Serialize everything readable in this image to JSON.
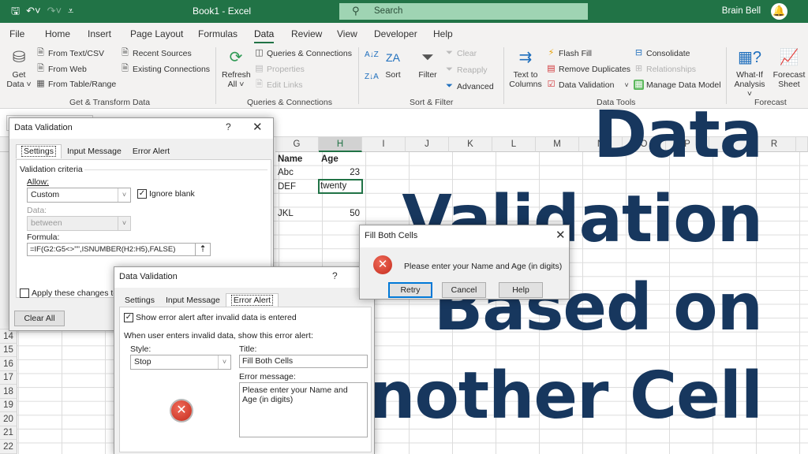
{
  "titlebar": {
    "title": "Book1  -  Excel",
    "search_placeholder": "Search",
    "user_name": "Brain Bell",
    "qat": [
      "save-icon",
      "undo-icon",
      "redo-icon",
      "customize-icon"
    ]
  },
  "menu": {
    "tabs": [
      "File",
      "Home",
      "Insert",
      "Page Layout",
      "Formulas",
      "Data",
      "Review",
      "View",
      "Developer",
      "Help"
    ],
    "active": "Data"
  },
  "ribbon": {
    "get_transform": {
      "label": "Get & Transform Data",
      "get_data": "Get",
      "get_data2": "Data ˅",
      "from_text_csv": "From Text/CSV",
      "from_web": "From Web",
      "from_table_range": "From Table/Range",
      "recent_sources": "Recent Sources",
      "existing_connections": "Existing Connections"
    },
    "queries": {
      "label": "Queries & Connections",
      "refresh": "Refresh",
      "refresh2": "All ˅",
      "queries_connections": "Queries & Connections",
      "properties": "Properties",
      "edit_links": "Edit Links"
    },
    "sort_filter": {
      "label": "Sort & Filter",
      "sort": "Sort",
      "filter": "Filter",
      "clear": "Clear",
      "reapply": "Reapply",
      "advanced": "Advanced"
    },
    "data_tools": {
      "label": "Data Tools",
      "text_to": "Text to",
      "columns": "Columns",
      "flash_fill": "Flash Fill",
      "remove_duplicates": "Remove Duplicates",
      "data_validation": "Data Validation",
      "consolidate": "Consolidate",
      "relationships": "Relationships",
      "manage_data_model": "Manage Data Model"
    },
    "forecast": {
      "label": "Forecast",
      "what_if": "What-If",
      "what_if2": "Analysis ˅",
      "forecast_sheet": "Forecast",
      "forecast_sheet2": "Sheet"
    }
  },
  "grid": {
    "columns": [
      "G",
      "H",
      "I",
      "J",
      "K",
      "L",
      "M",
      "N",
      "O",
      "P",
      "Q",
      "R"
    ],
    "selected_column": "H",
    "rows_visible": [
      "14",
      "15",
      "16",
      "17",
      "18",
      "19",
      "20",
      "21",
      "22"
    ],
    "cells": {
      "G1": "Name",
      "H1": "Age",
      "G2": "Abc",
      "H2": "23",
      "G3": "DEF",
      "H3": "twenty",
      "G5": "JKL",
      "H5": "50"
    },
    "active_cell": "H3"
  },
  "dv_settings": {
    "title": "Data Validation",
    "help": "?",
    "close": "✕",
    "tabs": [
      "Settings",
      "Input Message",
      "Error Alert"
    ],
    "active_tab": "Settings",
    "section": "Validation criteria",
    "allow_label": "Allow:",
    "allow_value": "Custom",
    "ignore_blank_label": "Ignore blank",
    "ignore_blank_checked": true,
    "data_label": "Data:",
    "data_value": "between",
    "formula_label": "Formula:",
    "formula_value": "=IF(G2:G5<>\"\",ISNUMBER(H2:H5),FALSE)",
    "apply_label": "Apply these changes to",
    "apply_checked": false,
    "clear_all": "Clear All"
  },
  "dv_error": {
    "title": "Data Validation",
    "help": "?",
    "close": "✕",
    "tabs": [
      "Settings",
      "Input Message",
      "Error Alert"
    ],
    "active_tab": "Error Alert",
    "show_alert_label": "Show error alert after invalid data is entered",
    "show_alert_checked": true,
    "section": "When user enters invalid data, show this error alert:",
    "style_label": "Style:",
    "style_value": "Stop",
    "title_label": "Title:",
    "title_value": "Fill Both Cells",
    "message_label": "Error message:",
    "message_value": "Please enter your Name and Age (in digits)"
  },
  "alert": {
    "title": "Fill Both Cells",
    "close": "✕",
    "message": "Please enter your Name and Age (in digits)",
    "buttons": [
      "Retry",
      "Cancel",
      "Help"
    ]
  },
  "overlay_title": [
    "Data",
    "Validation",
    "Based on",
    "Another Cell"
  ],
  "colors": {
    "excel_green": "#217346",
    "title_navy": "#17375e",
    "error_red": "#c42b1c"
  }
}
